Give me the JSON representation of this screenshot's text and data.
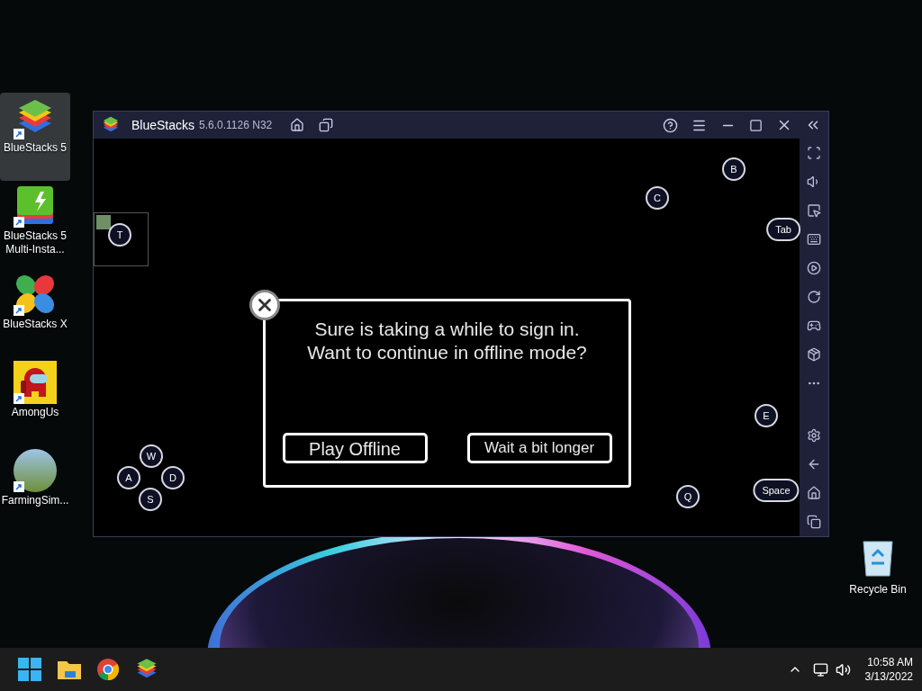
{
  "desktop_icons": [
    {
      "kind": "bluestacks",
      "label": "BlueStacks 5",
      "selected": true
    },
    {
      "kind": "multi",
      "label": "BlueStacks 5 Multi-Insta...",
      "selected": false
    },
    {
      "kind": "bsx",
      "label": "BlueStacks X",
      "selected": false
    },
    {
      "kind": "among",
      "label": "AmongUs",
      "selected": false
    },
    {
      "kind": "farm",
      "label": "FarmingSim...",
      "selected": false
    }
  ],
  "recycle_bin": {
    "label": "Recycle Bin"
  },
  "window": {
    "title": "BlueStacks",
    "version": "5.6.0.1126 N32"
  },
  "game": {
    "keys": [
      {
        "label": "B"
      },
      {
        "label": "C"
      },
      {
        "label": "Tab"
      },
      {
        "label": "T"
      },
      {
        "label": "E"
      },
      {
        "label": "Q"
      },
      {
        "label": "Space"
      },
      {
        "label": "W"
      },
      {
        "label": "A"
      },
      {
        "label": "D"
      },
      {
        "label": "S"
      }
    ],
    "dialog": {
      "lines": [
        "Sure is taking a while to sign in.",
        "Want to continue in offline mode?"
      ],
      "buttons": [
        "Play Offline",
        "Wait a bit longer"
      ]
    }
  },
  "taskbar": {
    "time": "10:58 AM",
    "date": "3/13/2022"
  }
}
